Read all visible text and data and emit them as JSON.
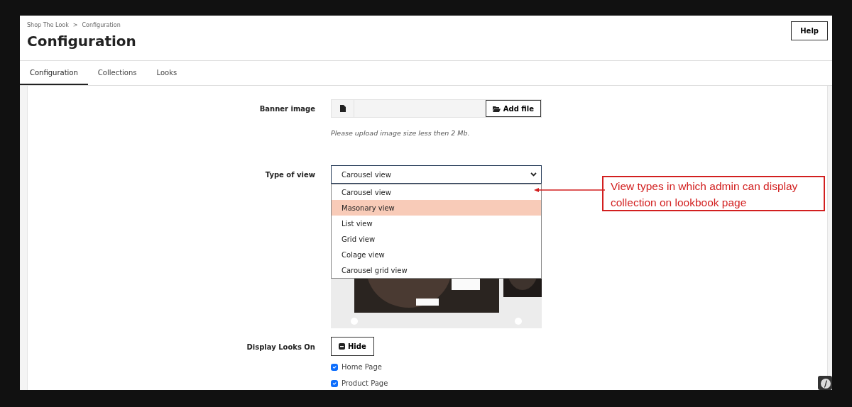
{
  "breadcrumb": {
    "items": [
      {
        "label": "Shop The Look"
      },
      {
        "label": "Configuration"
      }
    ],
    "separator": ">"
  },
  "page_title": "Configuration",
  "help_button": "Help",
  "tabs": [
    {
      "label": "Configuration",
      "selected": true
    },
    {
      "label": "Collections",
      "selected": false
    },
    {
      "label": "Looks",
      "selected": false
    }
  ],
  "form": {
    "banner_image": {
      "label": "Banner image",
      "button": "Add file",
      "hint": "Please upload image size less then 2 Mb."
    },
    "type_of_view": {
      "label": "Type of view",
      "value": "Carousel view",
      "expanded": true,
      "options": [
        {
          "label": "Carousel view",
          "highlighted": false
        },
        {
          "label": "Masonary view",
          "highlighted": true
        },
        {
          "label": "List view",
          "highlighted": false
        },
        {
          "label": "Grid view",
          "highlighted": false
        },
        {
          "label": "Colage view",
          "highlighted": false
        },
        {
          "label": "Carousel grid view",
          "highlighted": false
        }
      ]
    },
    "display_looks_on": {
      "label": "Display Looks On",
      "button": "Hide",
      "options": [
        {
          "label": "Home Page",
          "checked": true
        },
        {
          "label": "Product Page",
          "checked": true
        }
      ]
    }
  },
  "annotation": {
    "text": "View types in which admin can display collection on lookbook page"
  }
}
